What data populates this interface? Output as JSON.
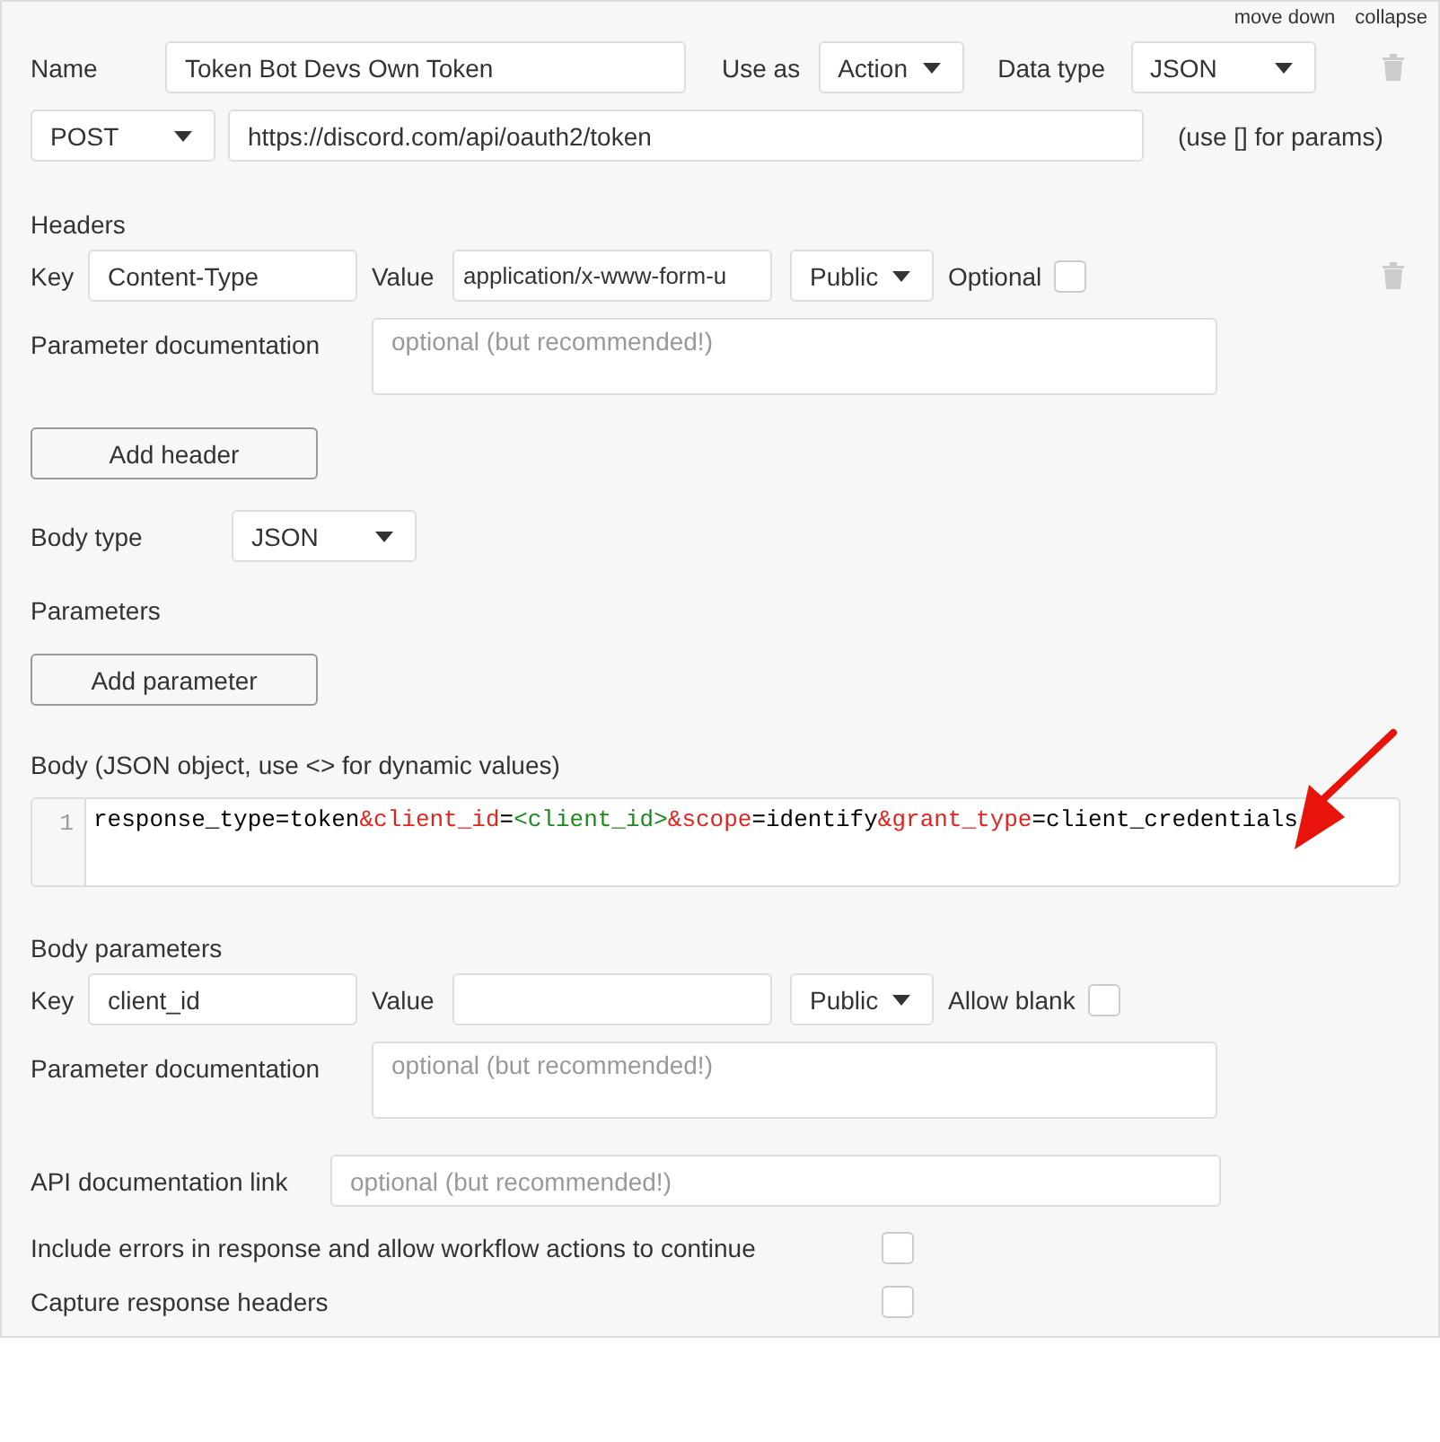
{
  "header_links": [
    "move down",
    "collapse"
  ],
  "name": {
    "label": "Name",
    "value": "Token Bot Devs Own Token"
  },
  "use_as": {
    "label": "Use as",
    "value": "Action"
  },
  "data_type": {
    "label": "Data type",
    "value": "JSON"
  },
  "method": {
    "value": "POST"
  },
  "url": {
    "value": "https://discord.com/api/oauth2/token",
    "hint": "(use [] for params)"
  },
  "headers": {
    "title": "Headers",
    "key_label": "Key",
    "key": "Content-Type",
    "value_label": "Value",
    "value": "application/x-www-form-u",
    "privacy": "Public",
    "optional_label": "Optional",
    "optional": false,
    "doc_label": "Parameter documentation",
    "doc_placeholder": "optional (but recommended!)",
    "add_button": "Add header"
  },
  "body_type": {
    "label": "Body type",
    "value": "JSON"
  },
  "parameters": {
    "title": "Parameters",
    "add_button": "Add parameter"
  },
  "body": {
    "label": "Body (JSON object, use <> for dynamic values)",
    "line_number": "1",
    "tokens": [
      {
        "kind": "plain",
        "text": "response_type=token"
      },
      {
        "kind": "key",
        "text": "&client_id"
      },
      {
        "kind": "plain",
        "text": "="
      },
      {
        "kind": "dynamic",
        "text": "<client_id>"
      },
      {
        "kind": "key",
        "text": "&scope"
      },
      {
        "kind": "plain",
        "text": "=identify"
      },
      {
        "kind": "key",
        "text": "&grant_type"
      },
      {
        "kind": "plain",
        "text": "=client_credentials"
      }
    ]
  },
  "body_parameters": {
    "title": "Body parameters",
    "key_label": "Key",
    "key": "client_id",
    "value_label": "Value",
    "privacy": "Public",
    "allow_blank_label": "Allow blank",
    "allow_blank": false,
    "doc_label": "Parameter documentation",
    "doc_placeholder": "optional (but recommended!)"
  },
  "api_doc": {
    "label": "API documentation link",
    "placeholder": "optional (but recommended!)"
  },
  "options": [
    {
      "label": "Include errors in response and allow workflow actions to continue",
      "checked": false
    },
    {
      "label": "Capture response headers",
      "checked": false
    }
  ]
}
